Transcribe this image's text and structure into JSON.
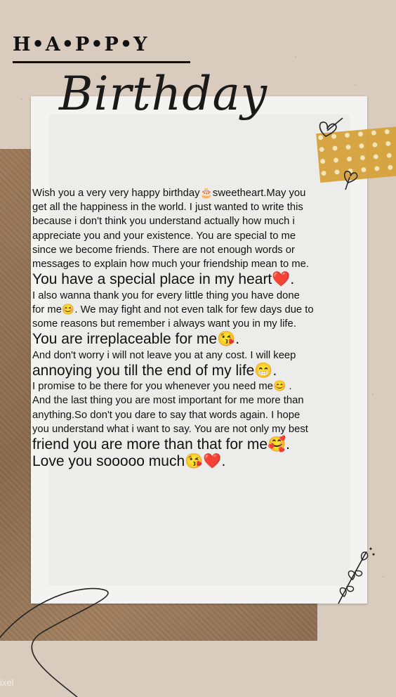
{
  "header": {
    "happy": "H•A•P•P•Y",
    "birthday": "Birthday"
  },
  "message": {
    "lines": [
      "Wish you a very very happy birthday🎂sweetheart.May you",
      "get all the happiness in the world. I just wanted to write this",
      "because i don't think you understand actually how much i",
      "appreciate you and your existence. You are special to me",
      "since we become friends. There are not enough words or",
      "messages to explain how much your friendship mean to me.",
      "You have a special place in my heart❤️.",
      "I also wanna thank you for every little thing you have done",
      "for me😊. We may fight and not even talk for few days due to",
      "some reasons but remember i always want you in my life.",
      "You are irreplaceable for me😘.",
      "And don't worry i will not leave you at any cost. I will keep",
      "annoying you till the end of my life😁.",
      "I promise to be there for you whenever you need me😊 .",
      "And the last thing you are most important for me more than",
      "anything.So don't you dare to say that words again. I hope",
      "you understand what i want to say. You are not only my best",
      "friend you are more than that for me🥰.",
      "Love you sooooo much😘❤️."
    ]
  },
  "watermark": "ixel",
  "colors": {
    "background": "#d9ccbf",
    "kraft": "#9c7a5a",
    "tape": "#d6a23b",
    "ink": "#111111"
  }
}
